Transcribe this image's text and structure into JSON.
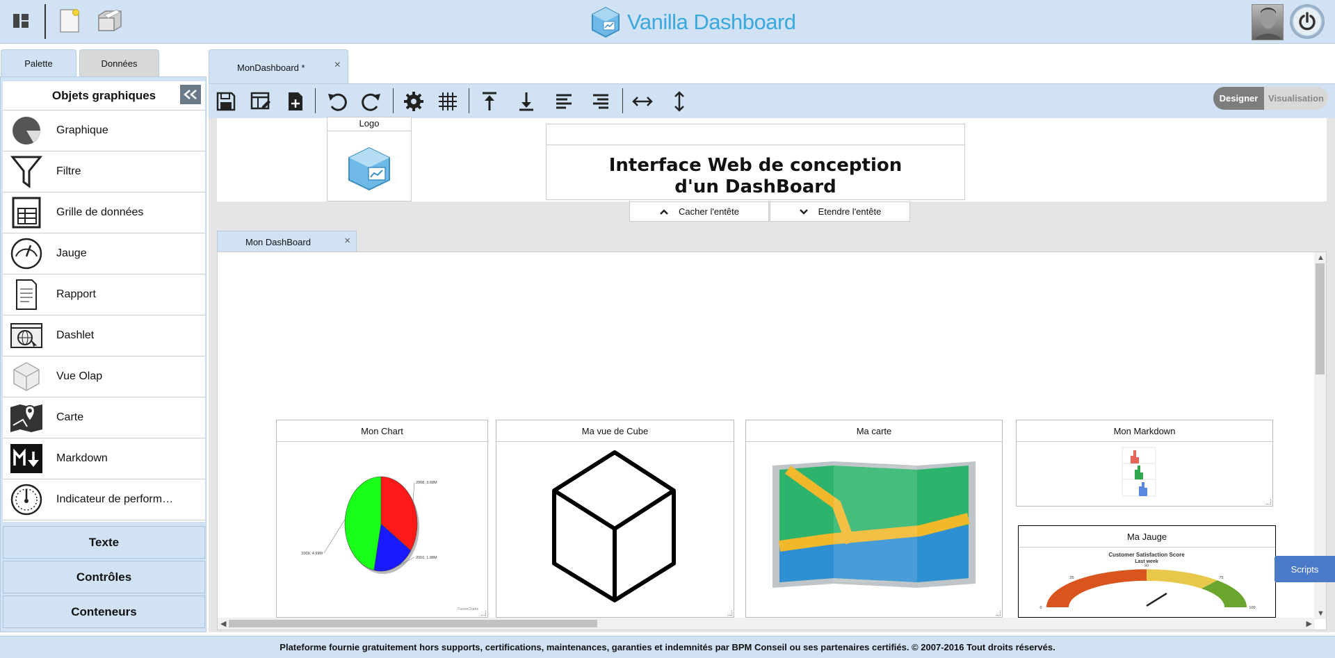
{
  "app": {
    "title": "Vanilla Dashboard"
  },
  "header": {
    "layout_icon": "layout-panels-icon",
    "new_icon": "new-document-icon",
    "open_icon": "open-folder-icon",
    "avatar": "user-avatar",
    "power_icon": "power-icon"
  },
  "left_tabs": [
    {
      "label": "Palette"
    },
    {
      "label": "Données"
    }
  ],
  "panel": {
    "title": "Objets graphiques",
    "items": [
      {
        "label": "Graphique",
        "icon": "pie-chart-icon"
      },
      {
        "label": "Filtre",
        "icon": "funnel-icon"
      },
      {
        "label": "Grille de données",
        "icon": "data-grid-icon"
      },
      {
        "label": "Jauge",
        "icon": "gauge-icon"
      },
      {
        "label": "Rapport",
        "icon": "report-icon"
      },
      {
        "label": "Dashlet",
        "icon": "web-dashlet-icon"
      },
      {
        "label": "Vue Olap",
        "icon": "cube-icon"
      },
      {
        "label": "Carte",
        "icon": "map-pin-icon"
      },
      {
        "label": "Markdown",
        "icon": "markdown-icon"
      },
      {
        "label": "Indicateur de perform…",
        "icon": "kpi-meter-icon"
      }
    ],
    "sections": [
      {
        "label": "Texte"
      },
      {
        "label": "Contrôles"
      },
      {
        "label": "Conteneurs"
      }
    ]
  },
  "doc_tab": {
    "label": "MonDashboard *",
    "close": "×"
  },
  "toolbar": {
    "buttons": [
      "save-icon",
      "layout-edit-icon",
      "add-page-icon",
      "undo-icon",
      "redo-icon",
      "settings-gear-icon",
      "grid-icon",
      "align-top-icon",
      "align-bottom-icon",
      "align-left-icon",
      "align-right-icon",
      "same-width-icon",
      "same-height-icon"
    ]
  },
  "modes": {
    "designer": "Designer",
    "visualisation": "Visualisation"
  },
  "dashboard_header": {
    "logo_caption": "Logo",
    "title_line1": "Interface Web de conception",
    "title_line2": "d'un DashBoard",
    "hide_label": "Cacher l'entête",
    "expand_label": "Etendre l'entête"
  },
  "sub_tab": {
    "label": "Mon DashBoard",
    "close": "×"
  },
  "widgets": {
    "chart_title": "Mon Chart",
    "cube_title": "Ma vue de Cube",
    "map_title": "Ma carte",
    "markdown_title": "Mon Markdown",
    "gauge_title": "Ma Jauge"
  },
  "chart_data": [
    {
      "type": "pie",
      "title": "",
      "slices": [
        {
          "label": "2008, 3.68M",
          "value": 3.68,
          "color": "#ff1a1a"
        },
        {
          "label": "2010, 1.98M",
          "value": 1.98,
          "color": "#1a1aff"
        },
        {
          "label": "2009, 4.99M",
          "value": 4.99,
          "color": "#1aff1a"
        }
      ],
      "credit": "FusionCharts"
    },
    {
      "type": "gauge",
      "title": "Customer Satisfaction Score",
      "subtitle": "Last week",
      "min": 0,
      "max": 100,
      "ticks": [
        "0",
        "25",
        "50",
        "75",
        "100"
      ],
      "value": 66,
      "colors": [
        "#d9541e",
        "#e8c84a",
        "#6aa52e"
      ]
    }
  ],
  "scripts_button": "Scripts",
  "footer": {
    "text": "Plateforme fournie gratuitement hors supports, certifications, maintenances, garanties et indemnités par BPM Conseil ou ses partenaires certifiés. © 2007-2016 Tout droits réservés."
  }
}
